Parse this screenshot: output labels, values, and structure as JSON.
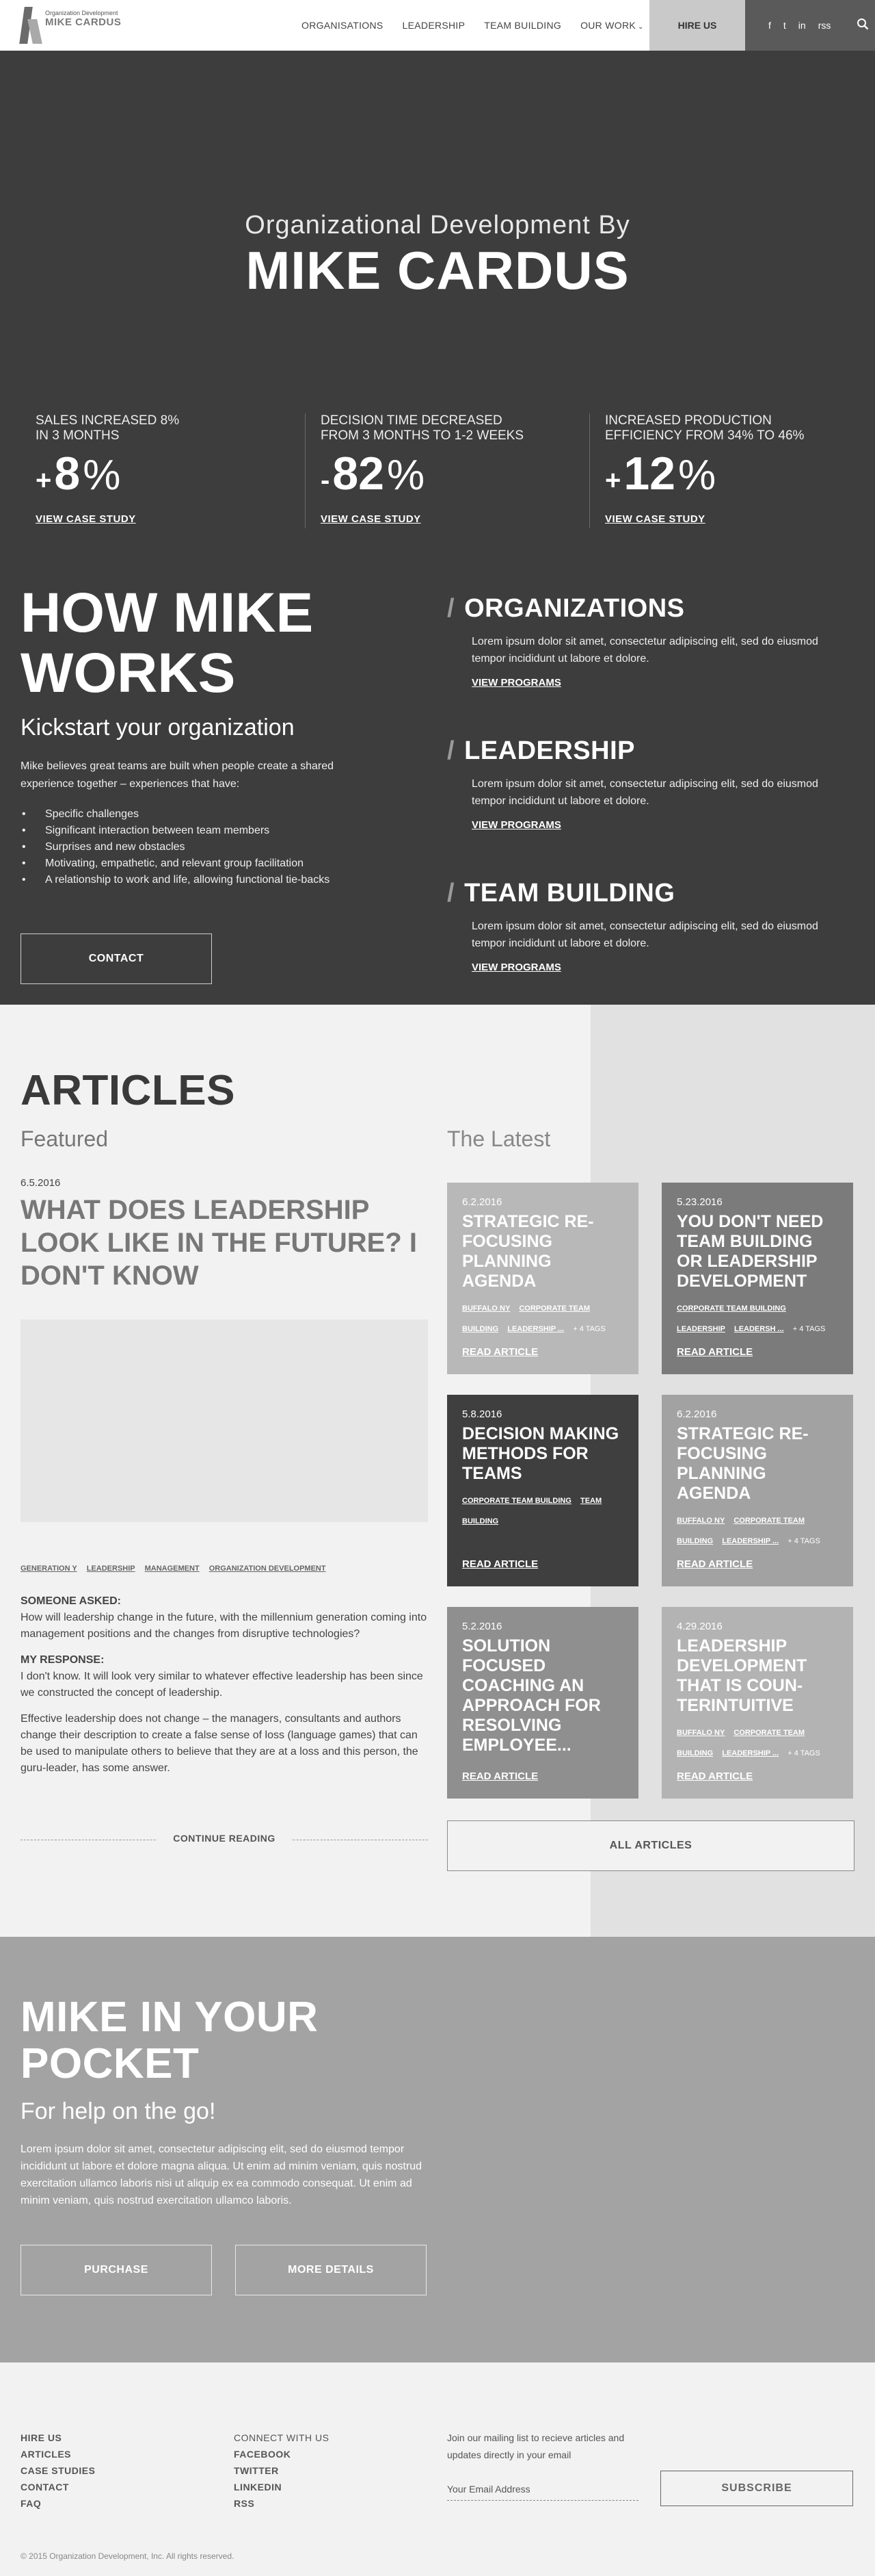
{
  "header": {
    "logo_small": "Organization Development",
    "logo_big": "MIKE CARDUS",
    "nav": [
      "ORGANISATIONS",
      "LEADERSHIP",
      "TEAM BUILDING",
      "OUR WORK"
    ],
    "hire": "HIRE US",
    "social_icons": [
      "facebook-icon",
      "twitter-icon",
      "linkedin-icon",
      "rss-icon"
    ],
    "social_glyphs": [
      "f",
      "t",
      "in",
      "rss"
    ]
  },
  "hero": {
    "subtitle": "Organizational Development By",
    "title": "MIKE CARDUS",
    "stats": [
      {
        "label": "SALES INCREASED 8%\nIN 3 MONTHS",
        "sign": "+",
        "value": "8",
        "unit": "%",
        "link": "VIEW CASE STUDY"
      },
      {
        "label": "DECISION TIME DECREASED\nFROM 3 MONTHS TO 1-2 WEEKS",
        "sign": "-",
        "value": "82",
        "unit": "%",
        "link": "VIEW CASE STUDY"
      },
      {
        "label": "INCREASED PRODUCTION\nEFFICIENCY FROM 34% TO 46%",
        "sign": "+",
        "value": "12",
        "unit": "%",
        "link": "VIEW CASE STUDY"
      }
    ]
  },
  "how": {
    "title": "HOW MIKE WORKS",
    "subtitle": "Kickstart your organization",
    "intro": "Mike believes great teams are built when people create a shared experience together – experiences that have:",
    "list": [
      "Specific challenges",
      "Significant interaction between team members",
      "Surprises and new obstacles",
      "Motivating, empathetic, and relevant group facilitation",
      "A relationship to work and life, allowing functional tie-backs"
    ],
    "contact": "CONTACT",
    "programs": [
      {
        "title": "ORGANIZATIONS",
        "text": "Lorem ipsum dolor sit amet, consectetur adipiscing elit, sed do eiusmod tempor incididunt ut labore et dolore.",
        "link": "VIEW PROGRAMS"
      },
      {
        "title": "LEADERSHIP",
        "text": "Lorem ipsum dolor sit amet, consectetur adipiscing elit, sed do eiusmod tempor incididunt ut labore et dolore.",
        "link": "VIEW PROGRAMS"
      },
      {
        "title": "TEAM BUILDING",
        "text": "Lorem ipsum dolor sit amet, consectetur adipiscing elit, sed do eiusmod tempor incididunt ut labore et dolore.",
        "link": "VIEW PROGRAMS"
      }
    ]
  },
  "articles": {
    "title": "ARTICLES",
    "featured_label": "Featured",
    "latest_label": "The Latest",
    "featured": {
      "date": "6.5.2016",
      "title": "WHAT DOES LEADERSHIP LOOK LIKE IN THE FUTURE? I DON'T KNOW",
      "tags": [
        "GENERATION Y",
        "LEADERSHIP",
        "MANAGEMENT",
        "ORGANIZATION DEVELOPMENT"
      ],
      "asked_label": "SOMEONE ASKED:",
      "asked_text": "How will leadership change in the future, with the millennium generation coming into management positions and the changes from disruptive technologies?",
      "response_label": "MY RESPONSE:",
      "response_text": "I don't know. It will look very similar to whatever effective leadership has been since we constructed the concept of leadership.",
      "body_text": "Effective leadership does not change – the managers, consultants and authors change their description to create a false sense of loss (language games) that can be used to manipulate others to believe that they are at a loss and this person, the guru-leader, has some answer.",
      "continue": "CONTINUE READING"
    },
    "cards": [
      {
        "date": "6.2.2016",
        "title": "STRATEGIC RE-FOCUSING PLANNING AGENDA",
        "tags": [
          "BUFFALO NY",
          "CORPORATE TEAM BUILDING",
          "LEADERSHIP ..."
        ],
        "more": "+ 4 TAGS",
        "link": "READ ARTICLE",
        "color": "#b8b8b8"
      },
      {
        "date": "5.23.2016",
        "title": "YOU DON'T NEED TEAM BUILDING OR LEADERSHIP DEVELOPMENT",
        "tags": [
          "CORPORATE TEAM BUILDING",
          "LEADERSHIP",
          "LEADERSH ..."
        ],
        "more": "+ 4 TAGS",
        "link": "READ ARTICLE",
        "color": "#7b7b7b"
      },
      {
        "date": "5.8.2016",
        "title": "DECISION MAKING METHODS FOR TEAMS",
        "tags": [
          "CORPORATE TEAM BUILDING",
          "TEAM BUILDING"
        ],
        "more": "",
        "link": "READ ARTICLE",
        "color": "#3f3f3f"
      },
      {
        "date": "6.2.2016",
        "title": "STRATEGIC RE-FOCUSING PLANNING AGENDA",
        "tags": [
          "BUFFALO NY",
          "CORPORATE TEAM BUILDING",
          "LEADERSHIP ..."
        ],
        "more": "+ 4 TAGS",
        "link": "READ ARTICLE",
        "color": "#a2a2a2"
      },
      {
        "date": "5.2.2016",
        "title": "SOLUTION FOCUSED COACHING AN APPROACH FOR RESOLVING EMPLOYEE...",
        "tags": [],
        "more": "",
        "link": "READ ARTICLE",
        "color": "#8f8f8f"
      },
      {
        "date": "4.29.2016",
        "title": "LEADERSHIP DEVELOPMENT THAT IS COUN-TERINTUITIVE",
        "tags": [
          "BUFFALO NY",
          "CORPORATE TEAM BUILDING",
          "LEADERSHIP ..."
        ],
        "more": "+ 4 TAGS",
        "link": "READ ARTICLE",
        "color": "#b3b3b3"
      }
    ],
    "all": "ALL ARTICLES"
  },
  "pocket": {
    "title": "MIKE IN YOUR POCKET",
    "subtitle": "For help on the go!",
    "text": "Lorem ipsum dolor sit amet, consectetur adipiscing elit, sed do eiusmod tempor incididunt ut labore et dolore magna aliqua. Ut enim ad minim veniam, quis nostrud exercitation ullamco laboris nisi ut aliquip ex ea commodo consequat. Ut enim ad minim veniam, quis nostrud exercitation ullamco laboris.",
    "purchase": "PURCHASE",
    "more": "MORE DETAILS"
  },
  "footer": {
    "col1": [
      "HIRE US",
      "ARTICLES",
      "CASE STUDIES",
      "CONTACT",
      "FAQ"
    ],
    "col2": [
      "CONNECT WITH US",
      "FACEBOOK",
      "TWITTER",
      "LINKEDIN",
      "RSS"
    ],
    "mail_text": "Join our mailing list to recieve articles and updates directly in your email",
    "email_placeholder": "Your Email Address",
    "subscribe": "SUBSCRIBE",
    "copyright": "© 2015 Organization Development, Inc. All rights reserved."
  },
  "colors": {
    "dark_bg": "#3d3d3d",
    "pocket_bg": "#a3a3a3",
    "light_bg": "#f2f2f2"
  }
}
